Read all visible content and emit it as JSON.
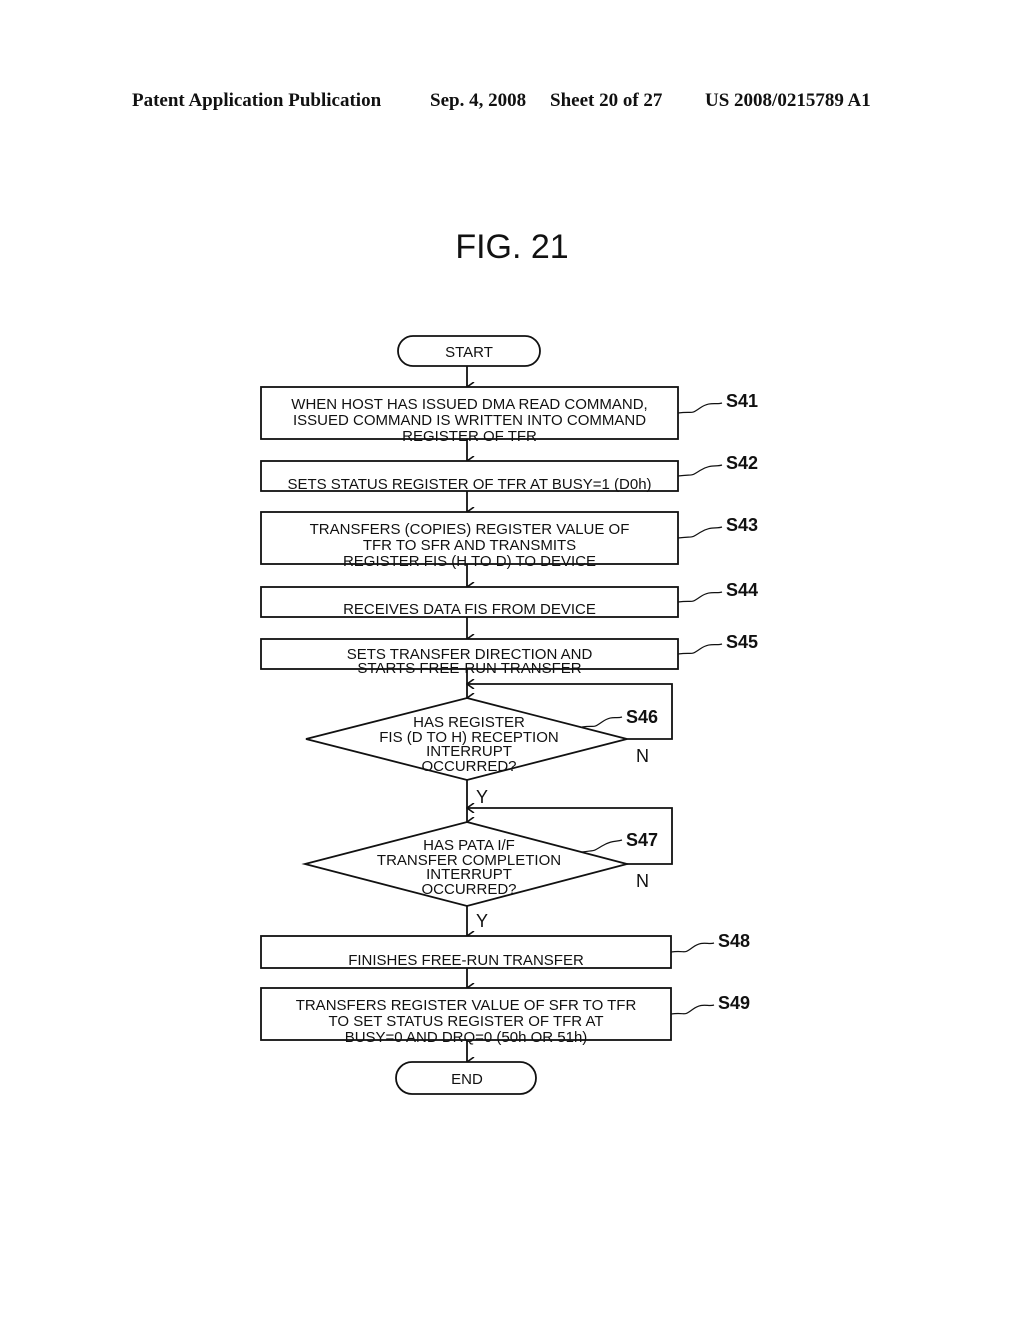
{
  "header": {
    "publication": "Patent Application Publication",
    "date": "Sep. 4, 2008",
    "sheet": "Sheet 20 of 27",
    "number": "US 2008/0215789 A1"
  },
  "figure": {
    "title": "FIG. 21",
    "start_label": "START",
    "end_label": "END",
    "steps": [
      {
        "id": "S41",
        "type": "process",
        "lines": [
          "WHEN HOST HAS ISSUED DMA READ COMMAND,",
          "ISSUED COMMAND IS WRITTEN INTO COMMAND",
          "REGISTER OF TFR"
        ]
      },
      {
        "id": "S42",
        "type": "process",
        "lines": [
          "SETS STATUS REGISTER OF TFR AT BUSY=1 (D0h)"
        ]
      },
      {
        "id": "S43",
        "type": "process",
        "lines": [
          "TRANSFERS (COPIES) REGISTER VALUE OF",
          "TFR TO SFR AND TRANSMITS",
          "REGISTER FIS (H TO D) TO DEVICE"
        ]
      },
      {
        "id": "S44",
        "type": "process",
        "lines": [
          "RECEIVES DATA FIS FROM DEVICE"
        ]
      },
      {
        "id": "S45",
        "type": "process",
        "lines": [
          "SETS TRANSFER DIRECTION AND",
          "STARTS FREE-RUN TRANSFER"
        ]
      },
      {
        "id": "S46",
        "type": "decision",
        "lines": [
          "HAS REGISTER",
          "FIS (D TO H) RECEPTION",
          "INTERRUPT",
          "OCCURRED?"
        ],
        "yes": "Y",
        "no": "N"
      },
      {
        "id": "S47",
        "type": "decision",
        "lines": [
          "HAS PATA I/F",
          "TRANSFER COMPLETION",
          "INTERRUPT",
          "OCCURRED?"
        ],
        "yes": "Y",
        "no": "N"
      },
      {
        "id": "S48",
        "type": "process",
        "lines": [
          "FINISHES FREE-RUN TRANSFER"
        ]
      },
      {
        "id": "S49",
        "type": "process",
        "lines": [
          "TRANSFERS REGISTER VALUE OF SFR TO TFR",
          "TO SET STATUS REGISTER OF TFR AT",
          "BUSY=0 AND DRQ=0 (50h OR 51h)"
        ]
      }
    ]
  }
}
